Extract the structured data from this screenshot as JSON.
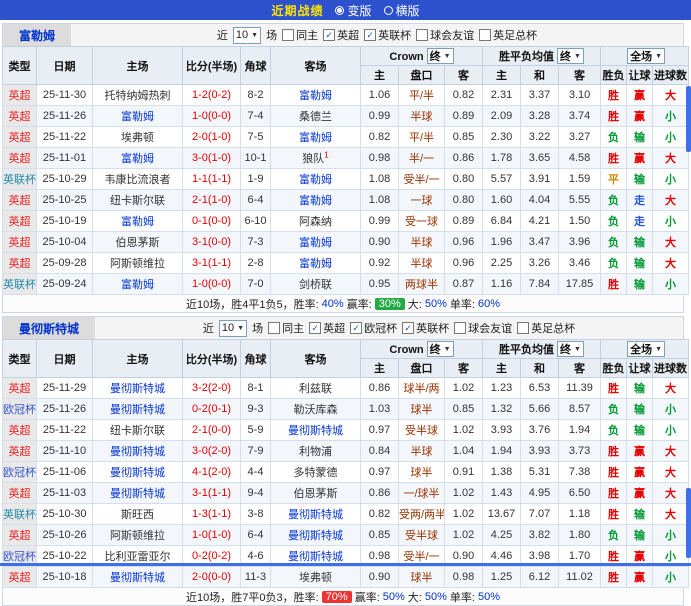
{
  "titlebar": {
    "title": "近期战绩",
    "mode_options": [
      {
        "label": "变版",
        "selected": true
      },
      {
        "label": "横版",
        "selected": false
      }
    ]
  },
  "colors": {
    "title_bar": "#2d51cc",
    "win": "#e60000",
    "loss": "#009933",
    "draw": "#cc8800",
    "push": "#2255dd",
    "team_link": "#0535d2",
    "badge_green": "#22aa44",
    "badge_red": "#ee3333"
  },
  "columns": {
    "type": "类型",
    "date": "日期",
    "home": "主场",
    "score": "比分(半场)",
    "corner": "角球",
    "away": "客场",
    "crown_group": "Crown",
    "crown_select": "终",
    "avg_group": "胜平负均值",
    "avg_select": "终",
    "scope_select": "全场",
    "crown_home": "主",
    "crown_line": "盘口",
    "crown_away": "客",
    "avg_home": "主",
    "avg_draw": "和",
    "avg_away": "客",
    "result": "胜负",
    "handicap": "让球",
    "goals": "进球数"
  },
  "sections": [
    {
      "team": "富勒姆",
      "filter": {
        "near": "近",
        "count": "10",
        "unit": "场",
        "checks": [
          {
            "label": "同主",
            "on": false
          },
          {
            "label": "英超",
            "on": true
          },
          {
            "label": "英联杯",
            "on": true
          },
          {
            "label": "球会友谊",
            "on": false
          },
          {
            "label": "英足总杯",
            "on": false
          }
        ]
      },
      "rows": [
        {
          "type": "英超",
          "date": "25-11-30",
          "home": "托特纳姆热刺",
          "home_sup": "",
          "score": "1-2(0-2)",
          "corner": "8-2",
          "away": "富勒姆",
          "away_sup": "",
          "ch": "1.06",
          "line": "平/半",
          "ca": "0.82",
          "oh": "2.31",
          "od": "3.37",
          "oa": "3.10",
          "res": "胜",
          "han": "赢",
          "goal": "大"
        },
        {
          "type": "英超",
          "date": "25-11-26",
          "home": "富勒姆",
          "home_sup": "",
          "score": "1-0(0-0)",
          "corner": "7-4",
          "away": "桑德兰",
          "away_sup": "",
          "ch": "0.99",
          "line": "半球",
          "ca": "0.89",
          "oh": "2.09",
          "od": "3.28",
          "oa": "3.74",
          "res": "胜",
          "han": "赢",
          "goal": "小"
        },
        {
          "type": "英超",
          "date": "25-11-22",
          "home": "埃弗顿",
          "home_sup": "",
          "score": "2-0(1-0)",
          "corner": "7-5",
          "away": "富勒姆",
          "away_sup": "",
          "ch": "0.82",
          "line": "平/半",
          "ca": "0.85",
          "oh": "2.30",
          "od": "3.22",
          "oa": "3.27",
          "res": "负",
          "han": "输",
          "goal": "小"
        },
        {
          "type": "英超",
          "date": "25-11-01",
          "home": "富勒姆",
          "home_sup": "",
          "score": "3-0(1-0)",
          "corner": "10-1",
          "away": "狼队",
          "away_sup": "1",
          "ch": "0.98",
          "line": "半/一",
          "ca": "0.86",
          "oh": "1.78",
          "od": "3.65",
          "oa": "4.58",
          "res": "胜",
          "han": "赢",
          "goal": "大"
        },
        {
          "type": "英联杯",
          "date": "25-10-29",
          "home": "韦康比流浪者",
          "home_sup": "",
          "score": "1-1(1-1)",
          "corner": "1-9",
          "away": "富勒姆",
          "away_sup": "",
          "ch": "1.08",
          "line": "受半/一",
          "ca": "0.80",
          "oh": "5.57",
          "od": "3.91",
          "oa": "1.59",
          "res": "平",
          "han": "输",
          "goal": "小"
        },
        {
          "type": "英超",
          "date": "25-10-25",
          "home": "纽卡斯尔联",
          "home_sup": "",
          "score": "2-1(1-0)",
          "corner": "6-4",
          "away": "富勒姆",
          "away_sup": "",
          "ch": "1.08",
          "line": "一球",
          "ca": "0.80",
          "oh": "1.60",
          "od": "4.04",
          "oa": "5.55",
          "res": "负",
          "han": "走",
          "goal": "大"
        },
        {
          "type": "英超",
          "date": "25-10-19",
          "home": "富勒姆",
          "home_sup": "",
          "score": "0-1(0-0)",
          "corner": "6-10",
          "away": "阿森纳",
          "away_sup": "",
          "ch": "0.99",
          "line": "受一球",
          "ca": "0.89",
          "oh": "6.84",
          "od": "4.21",
          "oa": "1.50",
          "res": "负",
          "han": "走",
          "goal": "小"
        },
        {
          "type": "英超",
          "date": "25-10-04",
          "home": "伯恩茅斯",
          "home_sup": "",
          "score": "3-1(0-0)",
          "corner": "7-3",
          "away": "富勒姆",
          "away_sup": "",
          "ch": "0.90",
          "line": "半球",
          "ca": "0.96",
          "oh": "1.96",
          "od": "3.47",
          "oa": "3.96",
          "res": "负",
          "han": "输",
          "goal": "大"
        },
        {
          "type": "英超",
          "date": "25-09-28",
          "home": "阿斯顿维拉",
          "home_sup": "",
          "score": "3-1(1-1)",
          "corner": "2-8",
          "away": "富勒姆",
          "away_sup": "",
          "ch": "0.92",
          "line": "半球",
          "ca": "0.96",
          "oh": "2.25",
          "od": "3.26",
          "oa": "3.46",
          "res": "负",
          "han": "输",
          "goal": "大"
        },
        {
          "type": "英联杯",
          "date": "25-09-24",
          "home": "富勒姆",
          "home_sup": "",
          "score": "1-0(0-0)",
          "corner": "7-0",
          "away": "剑桥联",
          "away_sup": "",
          "ch": "0.95",
          "line": "两球半",
          "ca": "0.87",
          "oh": "1.16",
          "od": "7.84",
          "oa": "17.85",
          "res": "胜",
          "han": "输",
          "goal": "小"
        }
      ],
      "summary": [
        {
          "text": "近10场，胜4平1负5，胜率:",
          "style": "s-plain"
        },
        {
          "text": "40%",
          "style": "s-blue"
        },
        {
          "text": "赢率:",
          "style": "s-plain"
        },
        {
          "text": "30%",
          "style": "s-badge-green"
        },
        {
          "text": "大:",
          "style": "s-plain"
        },
        {
          "text": "50%",
          "style": "s-blue"
        },
        {
          "text": "单率:",
          "style": "s-plain"
        },
        {
          "text": "60%",
          "style": "s-blue"
        }
      ]
    },
    {
      "team": "曼彻斯特城",
      "filter": {
        "near": "近",
        "count": "10",
        "unit": "场",
        "checks": [
          {
            "label": "同主",
            "on": false
          },
          {
            "label": "英超",
            "on": true
          },
          {
            "label": "欧冠杯",
            "on": true
          },
          {
            "label": "英联杯",
            "on": true
          },
          {
            "label": "球会友谊",
            "on": false
          },
          {
            "label": "英足总杯",
            "on": false
          }
        ]
      },
      "rows": [
        {
          "type": "英超",
          "date": "25-11-29",
          "home": "曼彻斯特城",
          "home_sup": "",
          "score": "3-2(2-0)",
          "corner": "8-1",
          "away": "利兹联",
          "away_sup": "",
          "ch": "0.86",
          "line": "球半/两",
          "ca": "1.02",
          "oh": "1.23",
          "od": "6.53",
          "oa": "11.39",
          "res": "胜",
          "han": "输",
          "goal": "大"
        },
        {
          "type": "欧冠杯",
          "date": "25-11-26",
          "home": "曼彻斯特城",
          "home_sup": "",
          "score": "0-2(0-1)",
          "corner": "9-3",
          "away": "勒沃库森",
          "away_sup": "",
          "ch": "1.03",
          "line": "球半",
          "ca": "0.85",
          "oh": "1.32",
          "od": "5.66",
          "oa": "8.57",
          "res": "负",
          "han": "输",
          "goal": "小"
        },
        {
          "type": "英超",
          "date": "25-11-22",
          "home": "纽卡斯尔联",
          "home_sup": "",
          "score": "2-1(0-0)",
          "corner": "5-9",
          "away": "曼彻斯特城",
          "away_sup": "",
          "ch": "0.97",
          "line": "受半球",
          "ca": "1.02",
          "oh": "3.93",
          "od": "3.76",
          "oa": "1.94",
          "res": "负",
          "han": "输",
          "goal": "小"
        },
        {
          "type": "英超",
          "date": "25-11-10",
          "home": "曼彻斯特城",
          "home_sup": "",
          "score": "3-0(2-0)",
          "corner": "7-9",
          "away": "利物浦",
          "away_sup": "",
          "ch": "0.84",
          "line": "半球",
          "ca": "1.04",
          "oh": "1.94",
          "od": "3.93",
          "oa": "3.73",
          "res": "胜",
          "han": "赢",
          "goal": "大"
        },
        {
          "type": "欧冠杯",
          "date": "25-11-06",
          "home": "曼彻斯特城",
          "home_sup": "",
          "score": "4-1(2-0)",
          "corner": "4-4",
          "away": "多特蒙德",
          "away_sup": "",
          "ch": "0.97",
          "line": "球半",
          "ca": "0.91",
          "oh": "1.38",
          "od": "5.31",
          "oa": "7.38",
          "res": "胜",
          "han": "赢",
          "goal": "大"
        },
        {
          "type": "英超",
          "date": "25-11-03",
          "home": "曼彻斯特城",
          "home_sup": "",
          "score": "3-1(1-1)",
          "corner": "9-4",
          "away": "伯恩茅斯",
          "away_sup": "",
          "ch": "0.86",
          "line": "一/球半",
          "ca": "1.02",
          "oh": "1.43",
          "od": "4.95",
          "oa": "6.50",
          "res": "胜",
          "han": "赢",
          "goal": "大"
        },
        {
          "type": "英联杯",
          "date": "25-10-30",
          "home": "斯旺西",
          "home_sup": "",
          "score": "1-3(1-1)",
          "corner": "3-8",
          "away": "曼彻斯特城",
          "away_sup": "",
          "ch": "0.82",
          "line": "受两/两半",
          "ca": "1.02",
          "oh": "13.67",
          "od": "7.07",
          "oa": "1.18",
          "res": "胜",
          "han": "输",
          "goal": "大"
        },
        {
          "type": "英超",
          "date": "25-10-26",
          "home": "阿斯顿维拉",
          "home_sup": "",
          "score": "1-0(1-0)",
          "corner": "6-4",
          "away": "曼彻斯特城",
          "away_sup": "",
          "ch": "0.85",
          "line": "受半球",
          "ca": "1.02",
          "oh": "4.25",
          "od": "3.82",
          "oa": "1.80",
          "res": "负",
          "han": "输",
          "goal": "小"
        },
        {
          "type": "欧冠杯",
          "date": "25-10-22",
          "home": "比利亚雷亚尔",
          "home_sup": "",
          "score": "0-2(0-2)",
          "corner": "4-6",
          "away": "曼彻斯特城",
          "away_sup": "",
          "ch": "0.98",
          "line": "受半/一",
          "ca": "0.90",
          "oh": "4.46",
          "od": "3.98",
          "oa": "1.70",
          "res": "胜",
          "han": "赢",
          "goal": "小"
        },
        {
          "type": "英超",
          "date": "25-10-18",
          "home": "曼彻斯特城",
          "home_sup": "",
          "score": "2-0(0-0)",
          "corner": "11-3",
          "away": "埃弗顿",
          "away_sup": "",
          "ch": "0.90",
          "line": "球半",
          "ca": "0.98",
          "oh": "1.25",
          "od": "6.12",
          "oa": "11.02",
          "res": "胜",
          "han": "赢",
          "goal": "小"
        }
      ],
      "summary": [
        {
          "text": "近10场，胜7平0负3，胜率:",
          "style": "s-plain"
        },
        {
          "text": "70%",
          "style": "s-badge-red"
        },
        {
          "text": "赢率:",
          "style": "s-plain"
        },
        {
          "text": "50%",
          "style": "s-blue"
        },
        {
          "text": "大:",
          "style": "s-plain"
        },
        {
          "text": "50%",
          "style": "s-blue"
        },
        {
          "text": "单率:",
          "style": "s-plain"
        },
        {
          "text": "50%",
          "style": "s-blue"
        }
      ]
    }
  ]
}
